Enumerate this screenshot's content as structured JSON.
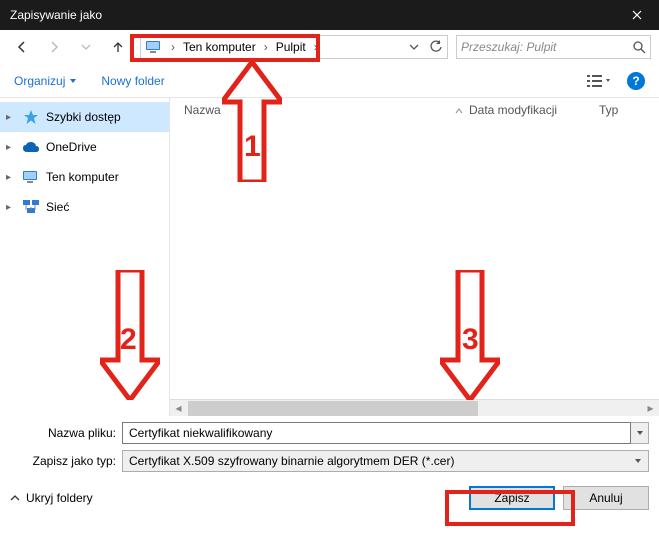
{
  "titlebar": {
    "title": "Zapisywanie jako"
  },
  "breadcrumb": {
    "root": "Ten komputer",
    "folder": "Pulpit"
  },
  "search": {
    "placeholder": "Przeszukaj: Pulpit"
  },
  "toolbar": {
    "organize": "Organizuj",
    "newfolder": "Nowy folder"
  },
  "columns": {
    "name": "Nazwa",
    "date": "Data modyfikacji",
    "type": "Typ"
  },
  "tree": {
    "quick": "Szybki dostęp",
    "onedrive": "OneDrive",
    "thispc": "Ten komputer",
    "network": "Sieć"
  },
  "fields": {
    "name_label": "Nazwa pliku:",
    "name_value": "Certyfikat niekwalifikowany",
    "type_label": "Zapisz jako typ:",
    "type_value": "Certyfikat X.509 szyfrowany binarnie algorytmem DER (*.cer)"
  },
  "buttons": {
    "hide": "Ukryj foldery",
    "save": "Zapisz",
    "cancel": "Anuluj"
  },
  "annotations": {
    "a1": "1",
    "a2": "2",
    "a3": "3"
  }
}
